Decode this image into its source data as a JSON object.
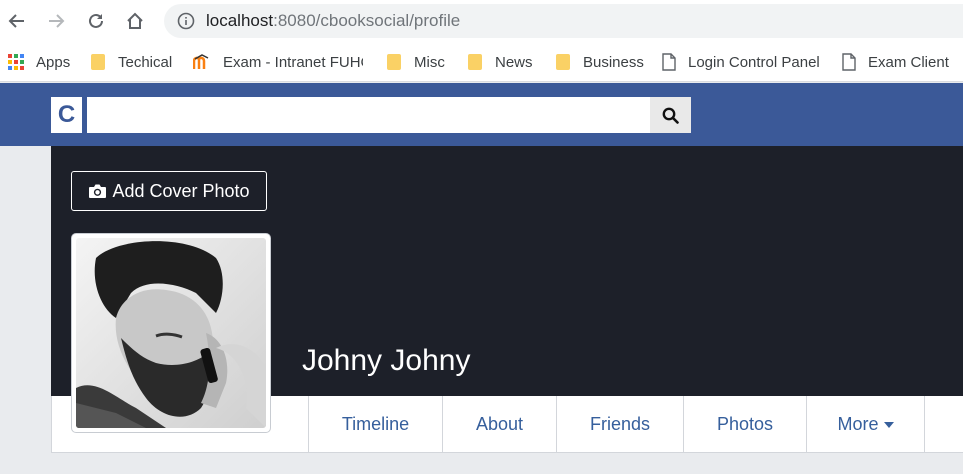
{
  "browser": {
    "url_host": "localhost",
    "url_path": ":8080/cbooksocial/profile",
    "bookmarks": [
      {
        "label": "Apps",
        "icon": "apps-grid-icon"
      },
      {
        "label": "Techical",
        "icon": "folder-icon"
      },
      {
        "label": "Exam - Intranet FUHC",
        "icon": "moodle-icon"
      },
      {
        "label": "Misc",
        "icon": "folder-icon"
      },
      {
        "label": "News",
        "icon": "folder-icon"
      },
      {
        "label": "Business",
        "icon": "folder-icon"
      },
      {
        "label": "Login Control Panel",
        "icon": "page-icon"
      },
      {
        "label": "Exam Client",
        "icon": "page-icon"
      }
    ]
  },
  "header": {
    "logo": "C",
    "search_placeholder": "",
    "brand_color": "#3b5998"
  },
  "profile": {
    "add_cover_label": "Add Cover Photo",
    "name": "Johny Johny",
    "tabs": [
      "Timeline",
      "About",
      "Friends",
      "Photos",
      "More"
    ]
  }
}
